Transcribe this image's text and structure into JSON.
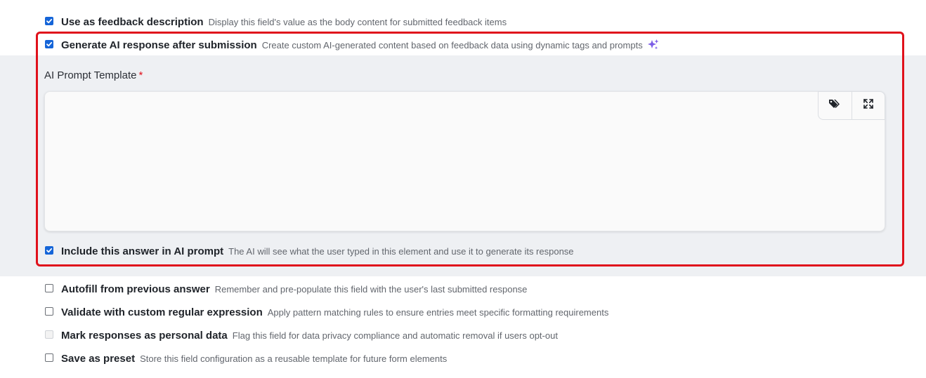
{
  "options": [
    {
      "label": "Use as feedback description",
      "description": "Display this field's value as the body content for submitted feedback items",
      "state": "checked"
    },
    {
      "label": "Generate AI response after submission",
      "description": "Create custom AI-generated content based on feedback data using dynamic tags and prompts",
      "state": "checked",
      "icon": "sparkle-icon"
    },
    {
      "label": "Include this answer in AI prompt",
      "description": "The AI will see what the user typed in this element and use it to generate its response",
      "state": "checked"
    },
    {
      "label": "Autofill from previous answer",
      "description": "Remember and pre-populate this field with the user's last submitted response",
      "state": "unchecked"
    },
    {
      "label": "Validate with custom regular expression",
      "description": "Apply pattern matching rules to ensure entries meet specific formatting requirements",
      "state": "unchecked"
    },
    {
      "label": "Mark responses as personal data",
      "description": "Flag this field for data privacy compliance and automatic removal if users opt-out",
      "state": "disabled"
    },
    {
      "label": "Save as preset",
      "description": "Store this field configuration as a reusable template for future form elements",
      "state": "unchecked"
    }
  ],
  "ai_prompt": {
    "label": "AI Prompt Template",
    "required_marker": "*",
    "value": "",
    "toolbar": [
      "tag-icon",
      "expand-icon"
    ]
  },
  "colors": {
    "accent": "#1565d8",
    "highlight_border": "#e0111b",
    "section_background": "#eef0f3",
    "sparkle": "#7b5ce6"
  }
}
